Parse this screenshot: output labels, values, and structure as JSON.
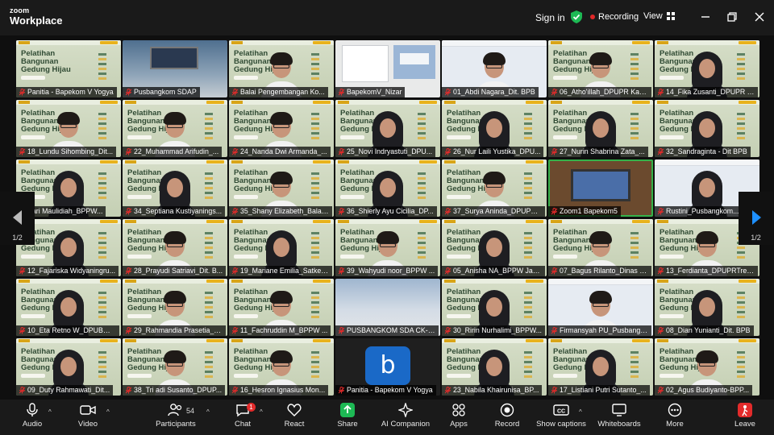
{
  "app": {
    "brand_top": "zoom",
    "brand_bottom": "Workplace"
  },
  "header": {
    "sign_in": "Sign in",
    "recording": "Recording",
    "view": "View"
  },
  "slide_title": "Pelatihan\nBangunan\nGedung Hijau",
  "pager": {
    "left": "1/2",
    "right": "1/2"
  },
  "tiles": [
    {
      "name": "Panitia - Bapekom V Yogya",
      "kind": "panitia"
    },
    {
      "name": "Pusbangkom SDAP",
      "kind": "stage"
    },
    {
      "name": "Balai Pengembangan Ko...",
      "kind": "slide-person"
    },
    {
      "name": "BapekomV_Nizar",
      "kind": "bapek"
    },
    {
      "name": "01_Abdi Nagara_Dit. BPB",
      "kind": "navy"
    },
    {
      "name": "06_Atho'illah_DPUPR Kab...",
      "kind": "slide-person"
    },
    {
      "name": "14_Fika Zusanti_DPUPR T...",
      "kind": "slide-hijab"
    },
    {
      "name": "18_Lundu Sihombing_Dit...",
      "kind": "slide-person"
    },
    {
      "name": "22_Muhammad Arifudin_...",
      "kind": "slide-person"
    },
    {
      "name": "24_Nanda Dwi Armanda_...",
      "kind": "slide-person"
    },
    {
      "name": "25_Novi Indryastuti_DPU...",
      "kind": "slide-hijab"
    },
    {
      "name": "26_Nur Laili Yustika_DPU...",
      "kind": "slide-hijab"
    },
    {
      "name": "27_Nurin Shabrina Zata_...",
      "kind": "slide-hijab"
    },
    {
      "name": "32_Sandraginta - Dit BPB",
      "kind": "slide-hijab"
    },
    {
      "name": "Sari Maulidiah_BPPW...",
      "kind": "slide-hijab"
    },
    {
      "name": "34_Septiana Kustiyanings...",
      "kind": "slide-hijab"
    },
    {
      "name": "35_Shany Elizabeth_Balai...",
      "kind": "slide-person"
    },
    {
      "name": "36_Shierly Ayu Cicilia_DP...",
      "kind": "slide-hijab"
    },
    {
      "name": "37_Surya Aninda_DPUPR...",
      "kind": "slide-person"
    },
    {
      "name": "Zoom1 Bapekom5",
      "kind": "room"
    },
    {
      "name": "Rustini_Pusbangkom...",
      "kind": "navy-hijab"
    },
    {
      "name": "12_Fajariska Widyaningru...",
      "kind": "slide-hijab"
    },
    {
      "name": "28_Prayudi Satriavi_Dit. B...",
      "kind": "slide-person"
    },
    {
      "name": "19_Mariane Emilia_Satker...",
      "kind": "slide-hijab"
    },
    {
      "name": "39_Wahyudi noor_BPPW ...",
      "kind": "slide-person"
    },
    {
      "name": "05_Anisha NA_BPPW Jate...",
      "kind": "slide-hijab"
    },
    {
      "name": "07_Bagus Rilanto_Dinas P...",
      "kind": "slide-person"
    },
    {
      "name": "13_Ferdianta_DPUPRTren...",
      "kind": "slide-person"
    },
    {
      "name": "10_Eta Retno W_DPUBMC...",
      "kind": "slide-hijab"
    },
    {
      "name": "29_Rahmandia Prasetia_B...",
      "kind": "slide-person"
    },
    {
      "name": "11_Fachruddin M_BPPW ...",
      "kind": "slide-person"
    },
    {
      "name": "PUSBANGKOM SDA CK-PS",
      "kind": "pus"
    },
    {
      "name": "30_Ririn Nurhalimi_BPPW...",
      "kind": "slide-hijab"
    },
    {
      "name": "Firmansyah PU_Pusbangk...",
      "kind": "navy"
    },
    {
      "name": "08_Dian Yunianti_Dit. BPB",
      "kind": "slide-hijab"
    },
    {
      "name": "09_Duty Rahmawati_Dit...",
      "kind": "slide-hijab"
    },
    {
      "name": "38_Tri adi Susanto_DPUP...",
      "kind": "slide-person"
    },
    {
      "name": "16_Hesron Ignasius Mon...",
      "kind": "slide-person"
    },
    {
      "name": "Panitia - Bapekom V Yogya",
      "kind": "b"
    },
    {
      "name": "23_Nabila Khairunisa_BP...",
      "kind": "slide-hijab"
    },
    {
      "name": "17_Listiani Putri Sutanto_...",
      "kind": "slide-hijab"
    },
    {
      "name": "02_Agus Budiyanto-BPP...",
      "kind": "slide-person"
    }
  ],
  "toolbar": {
    "audio": "Audio",
    "video": "Video",
    "participants": "Participants",
    "participants_count": "54",
    "chat": "Chat",
    "chat_badge": "1",
    "react": "React",
    "share": "Share",
    "ai": "AI Companion",
    "apps": "Apps",
    "record": "Record",
    "captions": "Show captions",
    "whiteboards": "Whiteboards",
    "more": "More",
    "leave": "Leave"
  },
  "colors": {
    "active_border": "#35b24a",
    "recording": "#e02828",
    "shield": "#1db954",
    "share": "#1db954",
    "leave": "#e32b2b",
    "pager_arrow": "#1e90ff"
  }
}
